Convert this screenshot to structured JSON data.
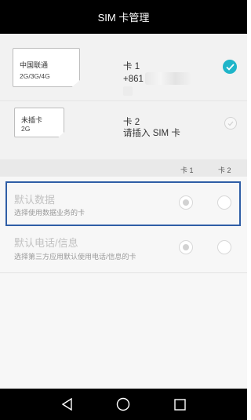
{
  "header": {
    "title": "SIM 卡管理"
  },
  "sims": [
    {
      "card_name": "中国联通",
      "network": "2G/3G/4G",
      "slot_label": "卡 1",
      "number": "+861",
      "selected": true
    },
    {
      "card_name": "未插卡",
      "network": "2G",
      "slot_label": "卡 2",
      "status": "请插入 SIM 卡",
      "selected": false
    }
  ],
  "columns": {
    "col1": "卡 1",
    "col2": "卡 2"
  },
  "options": [
    {
      "title": "默认数据",
      "subtitle": "选择使用数据业务的卡"
    },
    {
      "title": "默认电话/信息",
      "subtitle": "选择第三方应用默认使用电话/信息的卡"
    }
  ],
  "icons": {
    "check": "check-circle-icon",
    "back": "back-triangle-icon",
    "home": "home-circle-icon",
    "recents": "recents-square-icon"
  },
  "colors": {
    "accent": "#1fb5c9",
    "highlight": "#2f5ea6"
  }
}
